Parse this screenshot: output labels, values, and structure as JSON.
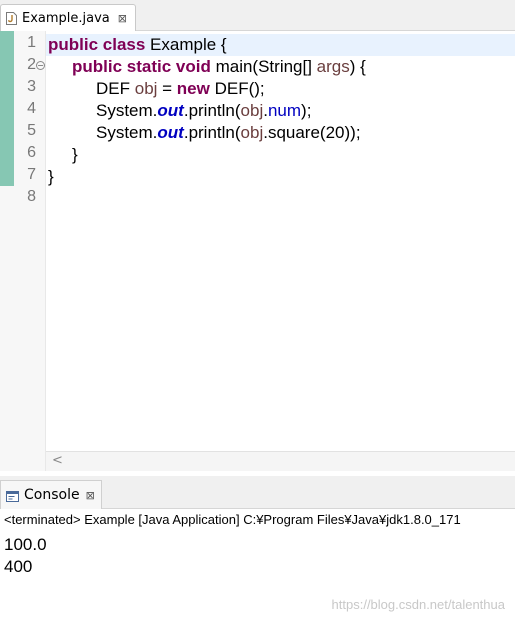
{
  "editor_tab": {
    "label": "Example.java",
    "close": "⊠"
  },
  "line_numbers": [
    "1",
    "2",
    "3",
    "4",
    "5",
    "6",
    "7",
    "8"
  ],
  "code": {
    "l1": {
      "kw": "public class",
      "rest": " Example {"
    },
    "l2": {
      "kw": "public static void",
      "pre": " main(String[] ",
      "arg": "args",
      "post": ") {"
    },
    "l3": {
      "t1": "DEF ",
      "var": "obj",
      "t2": " = ",
      "kw": "new",
      "t3": " DEF();"
    },
    "l4": {
      "t1": "System.",
      "sf": "out",
      "t2": ".println(",
      "var": "obj",
      "t3": ".",
      "field": "num",
      "t4": ");"
    },
    "l5": {
      "t1": "System.",
      "sf": "out",
      "t2": ".println(",
      "var": "obj",
      "t3": ".square(20));"
    },
    "l6": {
      "t1": "}"
    },
    "l7": {
      "t1": "}"
    }
  },
  "console_tab": {
    "label": "Console",
    "close": "⊠"
  },
  "console_status": "<terminated> Example [Java Application] C:¥Program Files¥Java¥jdk1.8.0_171",
  "console_output": [
    "100.0",
    "400"
  ],
  "watermark": "https://blog.csdn.net/talenthua",
  "colors": {
    "keyword": "#7f0055",
    "local_var": "#6a3e3e",
    "field": "#0000c0",
    "change_bar": "#86c7b3"
  }
}
